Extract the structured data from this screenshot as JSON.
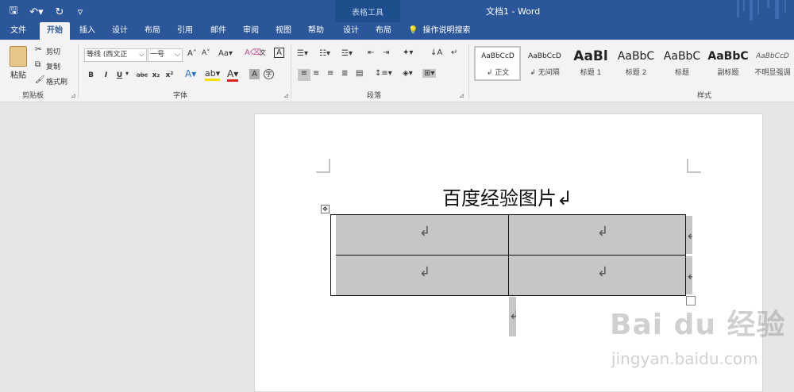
{
  "titlebar": {
    "context_tools_label": "表格工具",
    "doc_title": "文档1  -  Word",
    "qat": [
      {
        "icon": "save-icon",
        "glyph": "🖫"
      },
      {
        "icon": "undo-icon",
        "glyph": "↶▾"
      },
      {
        "icon": "redo-icon",
        "glyph": "↻"
      },
      {
        "icon": "customize-qat-icon",
        "glyph": "▿"
      }
    ]
  },
  "tabs": [
    {
      "label": "文件",
      "active": false
    },
    {
      "label": "开始",
      "active": true
    },
    {
      "label": "插入",
      "active": false
    },
    {
      "label": "设计",
      "active": false
    },
    {
      "label": "布局",
      "active": false
    },
    {
      "label": "引用",
      "active": false
    },
    {
      "label": "邮件",
      "active": false
    },
    {
      "label": "审阅",
      "active": false
    },
    {
      "label": "视图",
      "active": false
    },
    {
      "label": "帮助",
      "active": false
    },
    {
      "label": "设计",
      "active": false
    },
    {
      "label": "布局",
      "active": false
    }
  ],
  "tell_me": "操作说明搜索",
  "ribbon": {
    "clipboard": {
      "paste": "粘贴",
      "cut": "剪切",
      "copy": "复制",
      "format_painter": "格式刷",
      "group_label": "剪贴板"
    },
    "font": {
      "font_name": "等线 (西文正",
      "font_size": "一号",
      "group_label": "字体",
      "buttons": [
        "B",
        "I",
        "U",
        "abc",
        "x₂",
        "x²"
      ]
    },
    "paragraph": {
      "group_label": "段落"
    },
    "styles": {
      "group_label": "样式",
      "items": [
        {
          "preview": "AaBbCcD",
          "label": "↲ 正文",
          "selected": true
        },
        {
          "preview": "AaBbCcD",
          "label": "↲ 无间隔",
          "selected": false
        },
        {
          "preview": "AaBl",
          "label": "标题 1",
          "selected": false
        },
        {
          "preview": "AaBbC",
          "label": "标题 2",
          "selected": false
        },
        {
          "preview": "AaBbC",
          "label": "标题",
          "selected": false
        },
        {
          "preview": "AaBbC",
          "label": "副标题",
          "selected": false
        },
        {
          "preview": "AaBbCcD",
          "label": "不明显强调",
          "selected": false
        }
      ]
    }
  },
  "document": {
    "heading": "百度经验图片↲",
    "cell_mark": "↲",
    "end_mark": "↲",
    "move_handle_glyph": "✥"
  },
  "watermark": {
    "logo": "Bai du 经验",
    "url": "jingyan.baidu.com"
  }
}
